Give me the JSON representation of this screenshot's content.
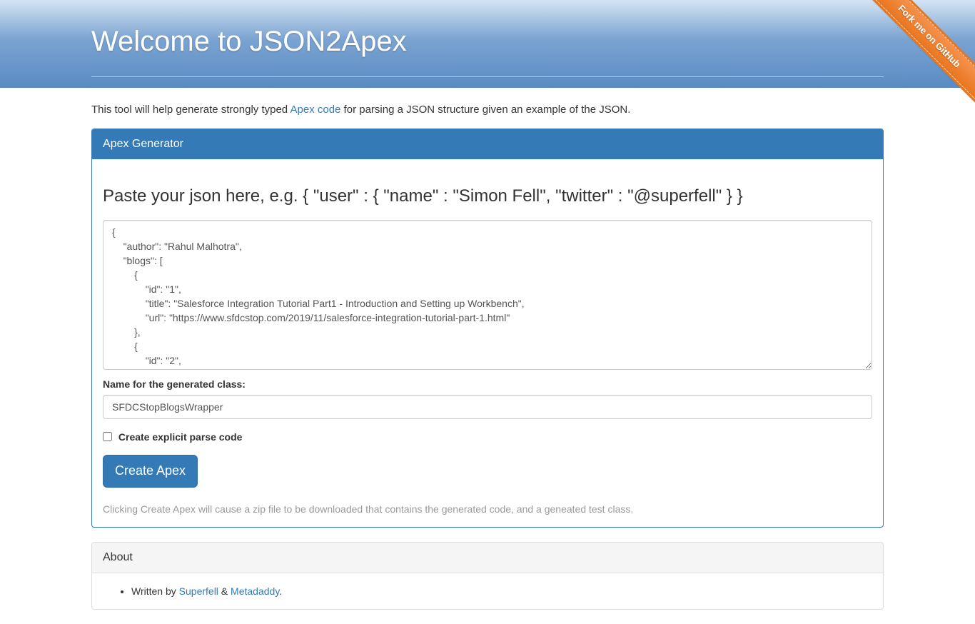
{
  "header": {
    "title": "Welcome to JSON2Apex"
  },
  "github_ribbon": "Fork me on GitHub",
  "intro": {
    "text_before": "This tool will help generate strongly typed ",
    "link_text": "Apex code",
    "text_after": " for parsing a JSON structure given an example of the JSON."
  },
  "panel": {
    "heading": "Apex Generator",
    "form_heading": "Paste your json here, e.g. { \"user\" : { \"name\" : \"Simon Fell\", \"twitter\" : \"@superfell\" } }",
    "textarea_value": "{\n    \"author\": \"Rahul Malhotra\",\n    \"blogs\": [\n        {\n            \"id\": \"1\",\n            \"title\": \"Salesforce Integration Tutorial Part1 - Introduction and Setting up Workbench\",\n            \"url\": \"https://www.sfdcstop.com/2019/11/salesforce-integration-tutorial-part-1.html\"\n        },\n        {\n            \"id\": \"2\",",
    "class_name_label": "Name for the generated class:",
    "class_name_value": "SFDCStopBlogsWrapper",
    "checkbox_label": "Create explicit parse code",
    "button_label": "Create Apex",
    "help_text": "Clicking Create Apex will cause a zip file to be downloaded that contains the generated code, and a geneated test class."
  },
  "about": {
    "heading": "About",
    "written_by_prefix": "Written by ",
    "author1": "Superfell",
    "separator": " & ",
    "author2": "Metadaddy",
    "suffix": "."
  }
}
